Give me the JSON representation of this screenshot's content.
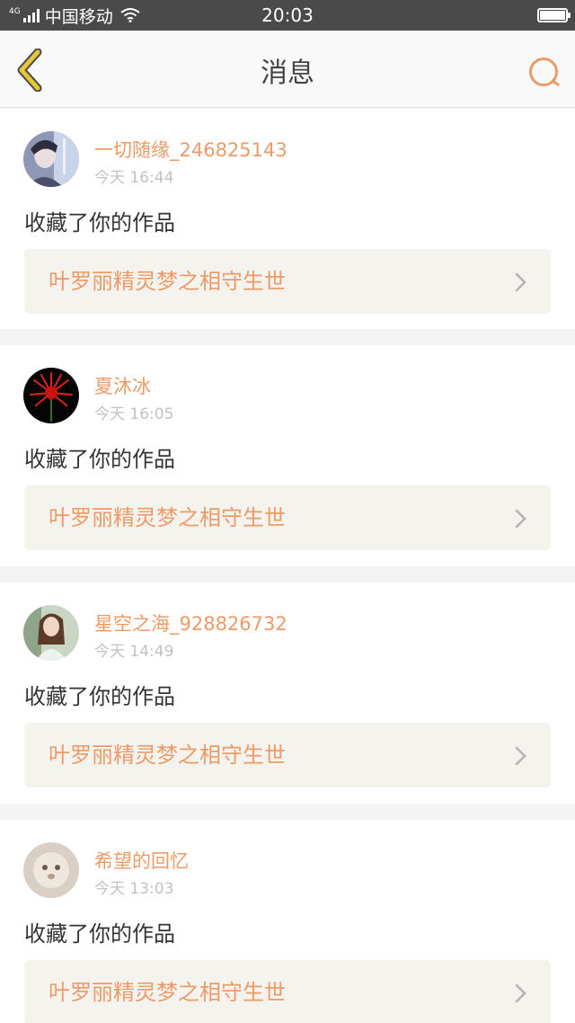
{
  "status_bar": {
    "network": "4G",
    "carrier": "中国移动",
    "time": "20:03"
  },
  "header": {
    "title": "消息",
    "back_icon": "back-chevron-icon",
    "search_icon": "search-icon"
  },
  "colors": {
    "accent": "#ee9a67",
    "back_icon": "#e8c63a",
    "status_bar_bg": "#4a4a4a",
    "card_bg": "#ffffff",
    "page_bg": "#f4f4f4",
    "link_box_bg": "#f4f3ee"
  },
  "messages": [
    {
      "username": "一切随缘_246825143",
      "time": "今天 16:44",
      "action": "收藏了你的作品",
      "work_title": "叶罗丽精灵梦之相守生世"
    },
    {
      "username": "夏沐冰",
      "time": "今天 16:05",
      "action": "收藏了你的作品",
      "work_title": "叶罗丽精灵梦之相守生世"
    },
    {
      "username": "星空之海_928826732",
      "time": "今天 14:49",
      "action": "收藏了你的作品",
      "work_title": "叶罗丽精灵梦之相守生世"
    },
    {
      "username": "希望的回忆",
      "time": "今天 13:03",
      "action": "收藏了你的作品",
      "work_title": "叶罗丽精灵梦之相守生世"
    }
  ]
}
